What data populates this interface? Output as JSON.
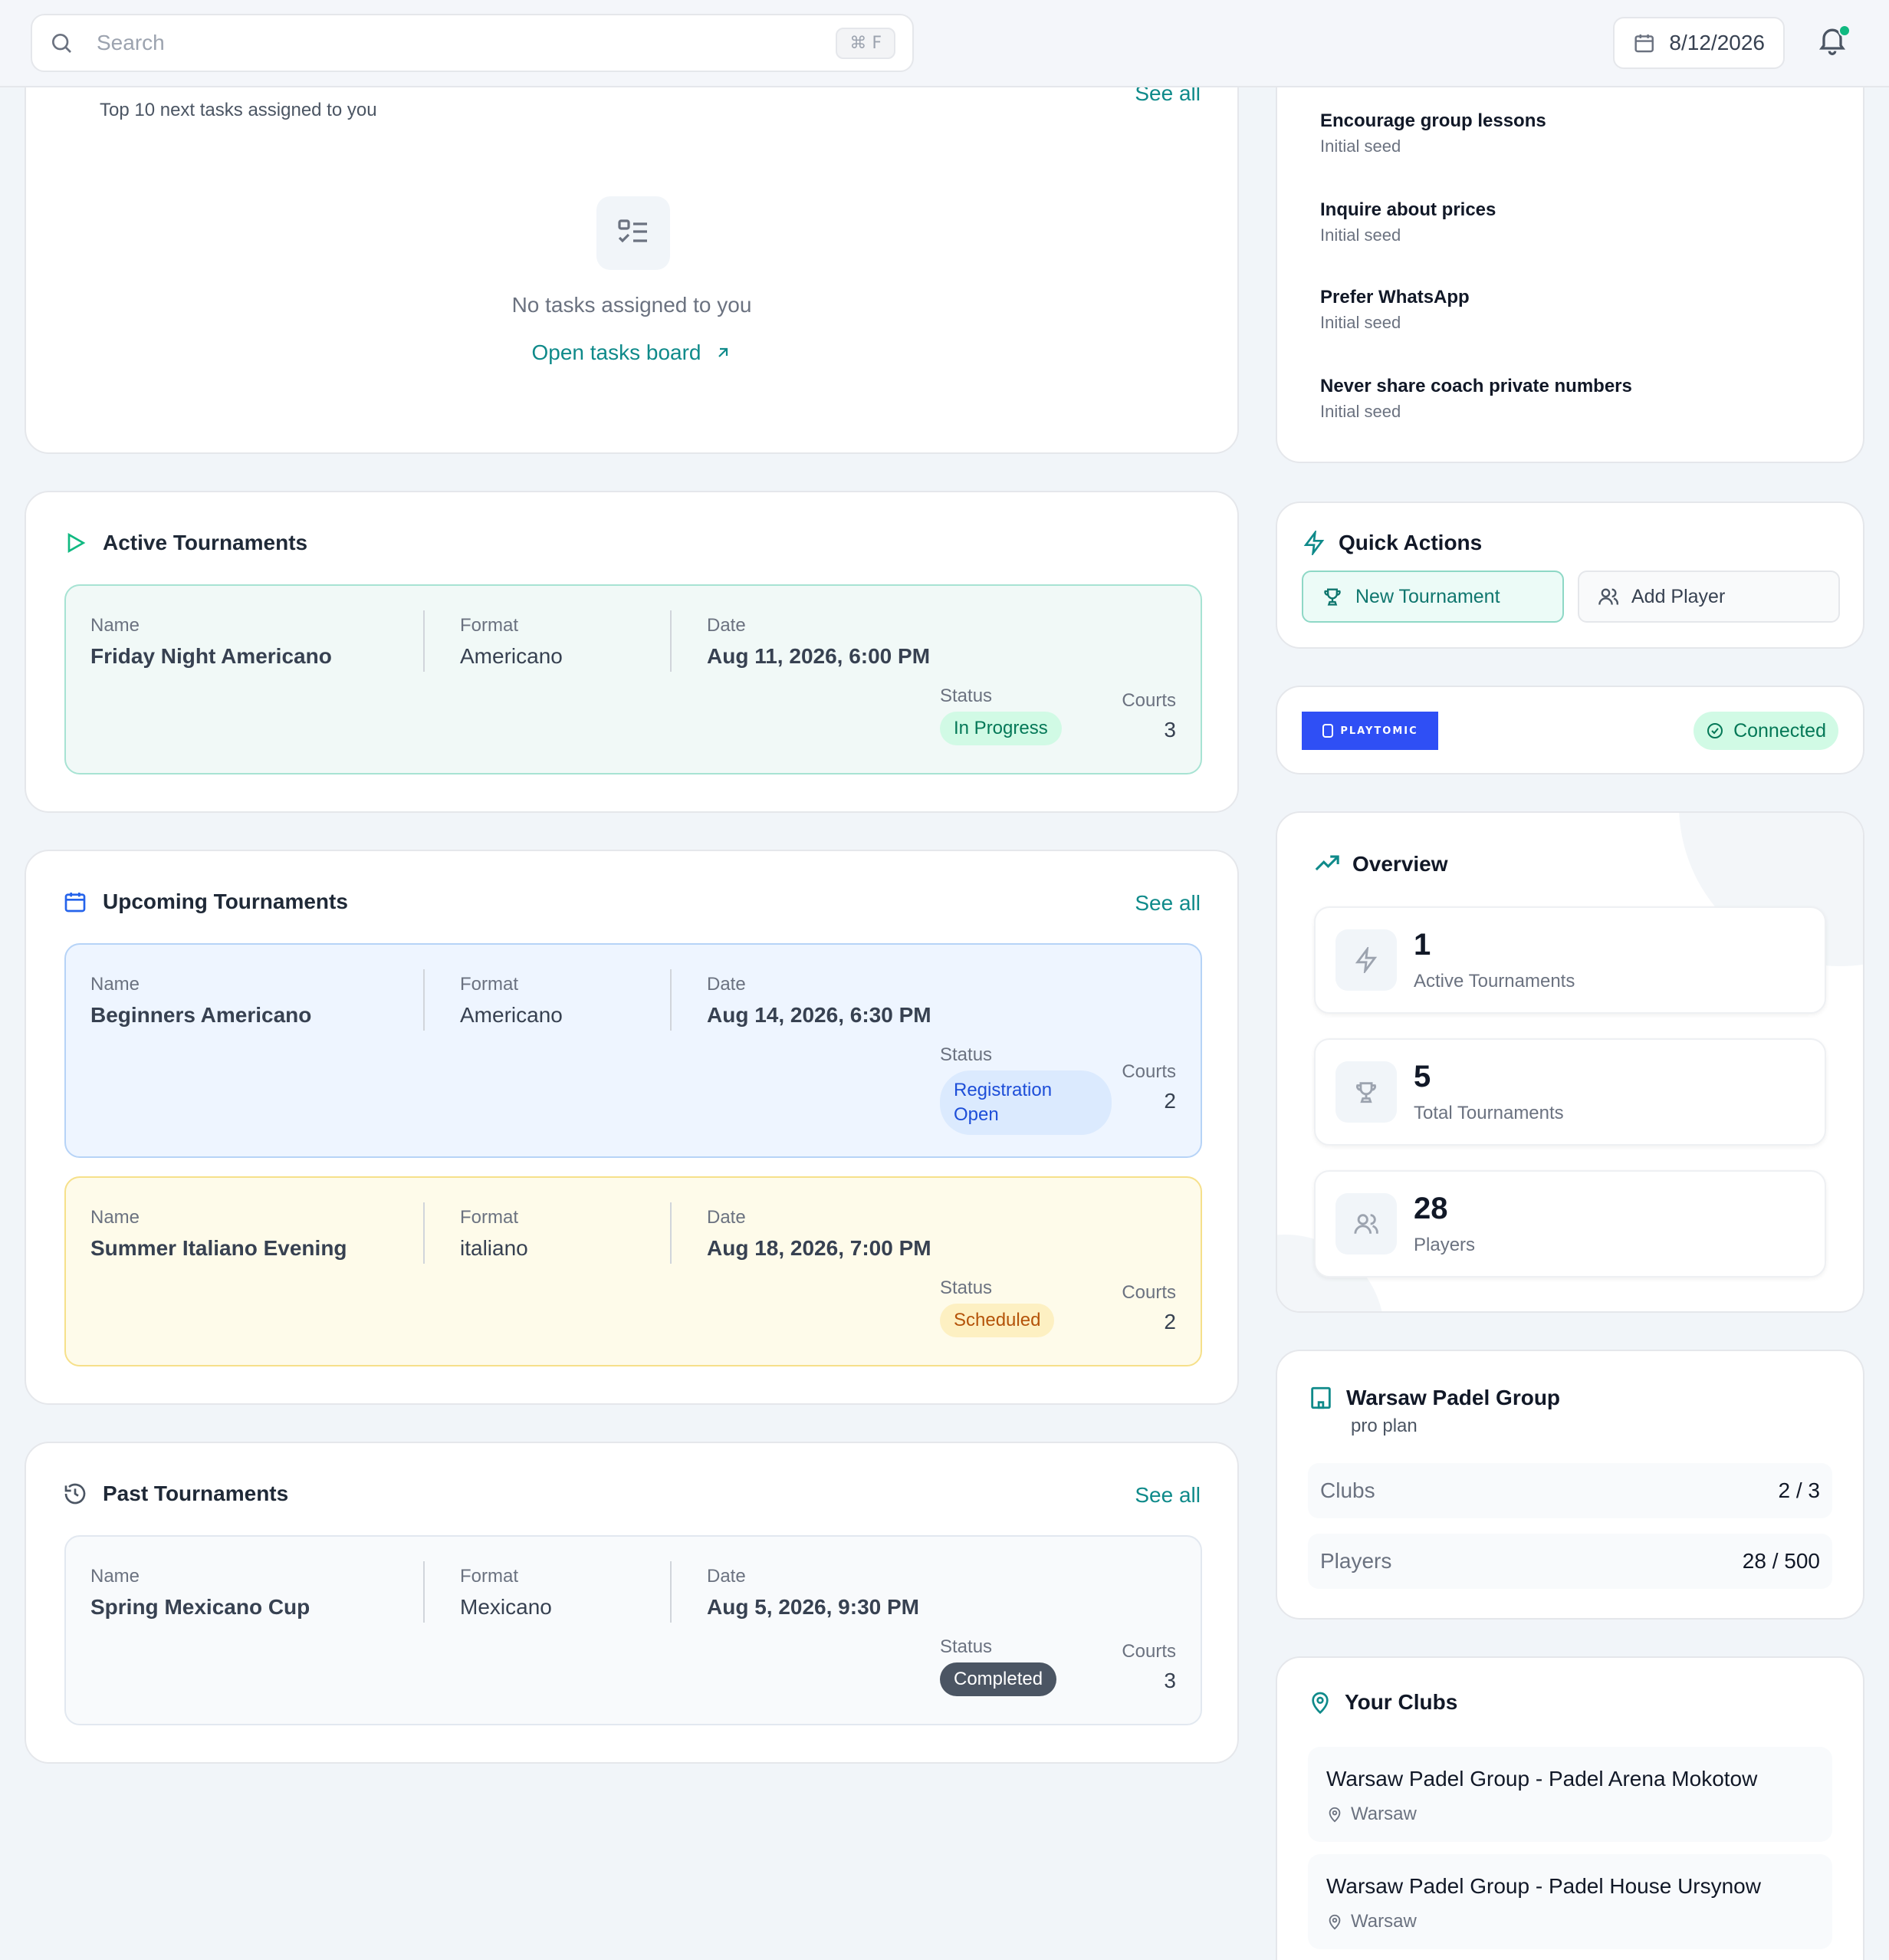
{
  "header": {
    "search_placeholder": "Search",
    "shortcut": "⌘  F",
    "date": "8/12/2026"
  },
  "tasks": {
    "subtitle": "Top 10 next tasks assigned to you",
    "see_all": "See all",
    "empty_text": "No tasks assigned to you",
    "open_board": "Open tasks board"
  },
  "notes": [
    {
      "title": "Encourage group lessons",
      "source": "Initial seed"
    },
    {
      "title": "Inquire about prices",
      "source": "Initial seed"
    },
    {
      "title": "Prefer WhatsApp",
      "source": "Initial seed"
    },
    {
      "title": "Never share coach private numbers",
      "source": "Initial seed"
    }
  ],
  "labels": {
    "name": "Name",
    "format": "Format",
    "date": "Date",
    "status": "Status",
    "courts": "Courts"
  },
  "active": {
    "title": "Active Tournaments",
    "items": [
      {
        "name": "Friday Night Americano",
        "format": "Americano",
        "date": "Aug 11, 2026, 6:00 PM",
        "status": "In Progress",
        "courts": "3"
      }
    ]
  },
  "upcoming": {
    "title": "Upcoming Tournaments",
    "see_all": "See all",
    "items": [
      {
        "name": "Beginners Americano",
        "format": "Americano",
        "date": "Aug 14, 2026, 6:30 PM",
        "status": "Registration Open",
        "courts": "2"
      },
      {
        "name": "Summer Italiano Evening",
        "format": "italiano",
        "date": "Aug 18, 2026, 7:00 PM",
        "status": "Scheduled",
        "courts": "2"
      }
    ]
  },
  "past": {
    "title": "Past Tournaments",
    "see_all": "See all",
    "items": [
      {
        "name": "Spring Mexicano Cup",
        "format": "Mexicano",
        "date": "Aug 5, 2026, 9:30 PM",
        "status": "Completed",
        "courts": "3"
      }
    ]
  },
  "quick_actions": {
    "title": "Quick Actions",
    "new_tournament": "New Tournament",
    "add_player": "Add Player"
  },
  "integration": {
    "logo_text": "PLAYTOMIC",
    "status": "Connected"
  },
  "overview": {
    "title": "Overview",
    "stats": [
      {
        "value": "1",
        "label": "Active Tournaments",
        "icon": "bolt-icon"
      },
      {
        "value": "5",
        "label": "Total Tournaments",
        "icon": "trophy-icon"
      },
      {
        "value": "28",
        "label": "Players",
        "icon": "users-icon"
      }
    ]
  },
  "organization": {
    "name": "Warsaw Padel Group",
    "plan": "pro plan",
    "clubs_label": "Clubs",
    "clubs_value": "2 / 3",
    "players_label": "Players",
    "players_value": "28 / 500"
  },
  "clubs": {
    "title": "Your Clubs",
    "items": [
      {
        "name": "Warsaw Padel Group - Padel Arena Mokotow",
        "city": "Warsaw"
      },
      {
        "name": "Warsaw Padel Group - Padel House Ursynow",
        "city": "Warsaw"
      }
    ]
  },
  "colors": {
    "accent": "#0f8a8a",
    "in_progress": "#047857",
    "registration": "#1d4ed8",
    "scheduled": "#b45309",
    "completed": "#4b5563",
    "playtomic": "#2f4ff5"
  }
}
